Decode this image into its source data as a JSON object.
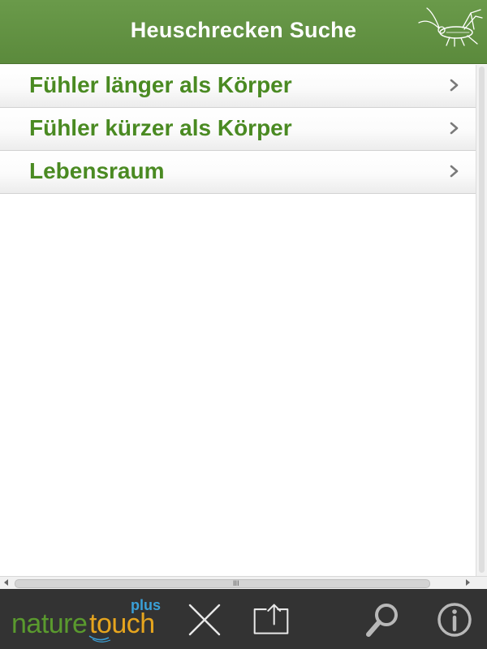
{
  "header": {
    "title": "Heuschrecken Suche",
    "icon": "grasshopper-icon"
  },
  "menu": {
    "items": [
      {
        "label": "Fühler länger als Körper",
        "icon": "chevron-right-icon"
      },
      {
        "label": "Fühler kürzer als Körper",
        "icon": "chevron-right-icon"
      },
      {
        "label": "Lebensraum",
        "icon": "chevron-right-icon"
      }
    ]
  },
  "scrollbar": {
    "grip": "III"
  },
  "toolbar": {
    "brand": {
      "nature": "nature",
      "touch": "touch",
      "plus": "plus"
    },
    "buttons": [
      {
        "name": "close",
        "icon": "close-icon"
      },
      {
        "name": "share",
        "icon": "share-icon"
      },
      {
        "name": "search",
        "icon": "search-icon"
      },
      {
        "name": "info",
        "icon": "info-icon"
      }
    ]
  },
  "colors": {
    "header_bg": "#5b8a3c",
    "item_text": "#4a8a22",
    "toolbar_bg": "#333333",
    "brand_green": "#5a9a2e",
    "brand_orange": "#e6a51e",
    "brand_blue": "#3aa0d8"
  }
}
